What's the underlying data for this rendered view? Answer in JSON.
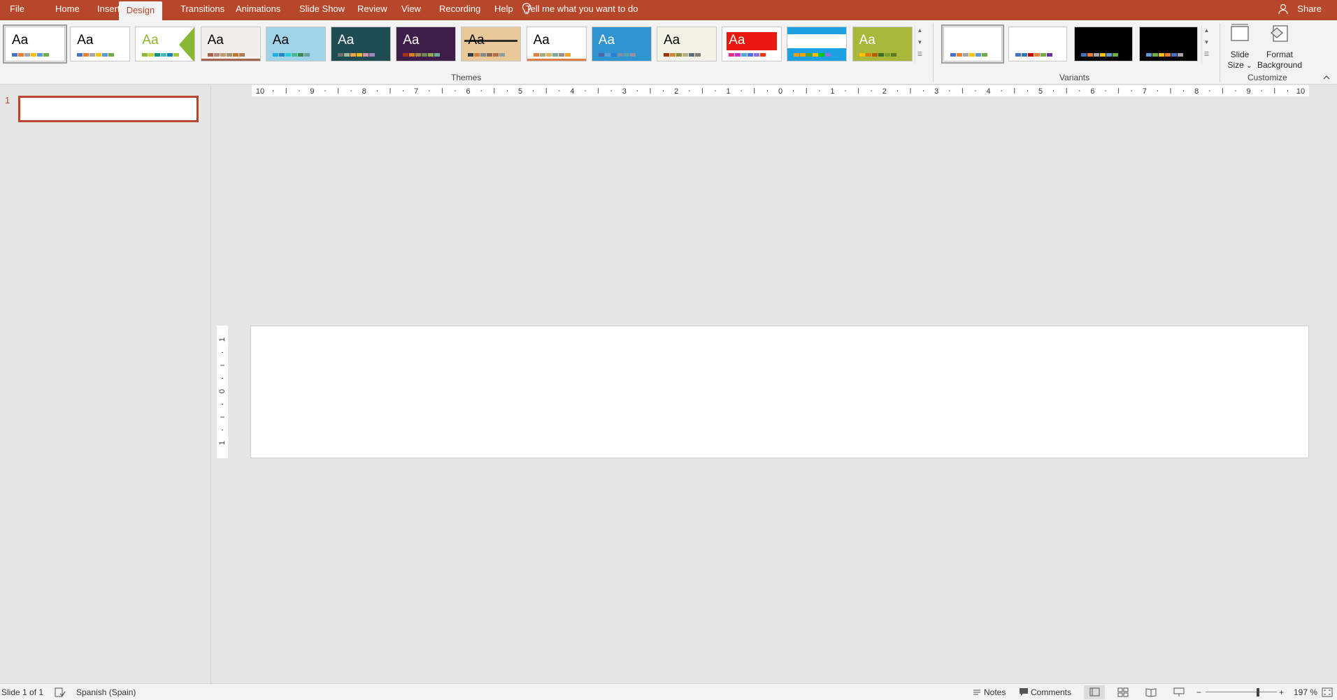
{
  "tabs": [
    {
      "label": "File",
      "active": false
    },
    {
      "label": "Home",
      "active": false
    },
    {
      "label": "Insert",
      "active": false
    },
    {
      "label": "Design",
      "active": true
    },
    {
      "label": "Transitions",
      "active": false
    },
    {
      "label": "Animations",
      "active": false
    },
    {
      "label": "Slide Show",
      "active": false
    },
    {
      "label": "Review",
      "active": false
    },
    {
      "label": "View",
      "active": false
    },
    {
      "label": "Recording",
      "active": false
    },
    {
      "label": "Help",
      "active": false
    }
  ],
  "tell_me": "Tell me what you want to do",
  "share": "Share",
  "ribbon": {
    "themes_label": "Themes",
    "variants_label": "Variants",
    "customize_label": "Customize",
    "theme_aa": "Aa",
    "slide_size": {
      "line1": "Slide",
      "line2": "Size",
      "arrow": "⌄"
    },
    "format_background": {
      "line1": "Format",
      "line2": "Background"
    }
  },
  "themes": [
    {
      "bg": "#ffffff",
      "fg": "#000000",
      "sw": [
        "#4472c4",
        "#ed7d31",
        "#a5a5a5",
        "#ffc000",
        "#5b9bd5",
        "#70ad47"
      ]
    },
    {
      "bg": "#ffffff",
      "fg": "#000000",
      "sw": [
        "#4472c4",
        "#ed7d31",
        "#a5a5a5",
        "#ffc000",
        "#5b9bd5",
        "#70ad47"
      ]
    },
    {
      "bg": "#ffffff",
      "fg": "#8ab833",
      "sw": [
        "#8ab833",
        "#c0cf3a",
        "#029676",
        "#4ab5c4",
        "#0989b1",
        "#a5c249"
      ]
    },
    {
      "bg": "#f2eeea",
      "fg": "#000000",
      "sw": [
        "#a5644e",
        "#b58b80",
        "#c3986d",
        "#a19574",
        "#c17529",
        "#b47a51"
      ]
    },
    {
      "bg": "#9ed3e8",
      "fg": "#000000",
      "sw": [
        "#1cade4",
        "#2683c6",
        "#27ced7",
        "#42ba97",
        "#3e8853",
        "#62a39f"
      ]
    },
    {
      "bg": "#1f4b52",
      "fg": "#ffffff",
      "sw": [
        "#6f6f74",
        "#a5b592",
        "#f3a447",
        "#e7bc29",
        "#d092a7",
        "#9c85c0"
      ]
    },
    {
      "bg": "#3f1d4a",
      "fg": "#ffffff",
      "sw": [
        "#a53010",
        "#de7e18",
        "#9f8351",
        "#728653",
        "#92aa4c",
        "#6aac91"
      ]
    },
    {
      "bg": "#e9c89a",
      "fg": "#000000",
      "sw": [
        "#2e3d49",
        "#d57d3a",
        "#7f8c8d",
        "#8d6b50",
        "#b56b4a",
        "#8b9f9f"
      ]
    },
    {
      "bg": "#ffffff",
      "fg": "#000000",
      "sw": [
        "#dd8047",
        "#a5ab81",
        "#d8b25c",
        "#7ba79d",
        "#968c8c",
        "#f0a22e"
      ]
    },
    {
      "bg": "#2f94cf",
      "fg": "#ffffff",
      "sw": [
        "#4a66ac",
        "#629dd1",
        "#297fd5",
        "#7f8fa9",
        "#5aa2ae",
        "#9d90a0"
      ]
    },
    {
      "bg": "#f2f2e6",
      "fg": "#000000",
      "sw": [
        "#9e3611",
        "#d6862d",
        "#8c8c3c",
        "#b4b080",
        "#586d7f",
        "#877b6f"
      ]
    },
    {
      "bg": "#ffffff",
      "fg": "#ffffff",
      "sw": [
        "#e32d91",
        "#c830cc",
        "#4ea6dc",
        "#4775e7",
        "#8971e1",
        "#f30"
      ]
    },
    {
      "bg": "#1ba1e2",
      "fg": "#ffffff",
      "sw": [
        "#f59e00",
        "#f59e00",
        "#62a420",
        "#ffc000",
        "#0c0",
        "#9370db"
      ]
    },
    {
      "bg": "#a9b83a",
      "fg": "#ffffff",
      "sw": [
        "#ffc000",
        "#d97b09",
        "#b45f06",
        "#3d6b1f",
        "#7e9d28",
        "#5b7d2b"
      ]
    }
  ],
  "variants": [
    {
      "bg": "#ffffff",
      "sw": [
        "#4472c4",
        "#ed7d31",
        "#a5a5a5",
        "#ffc000",
        "#5b9bd5",
        "#70ad47"
      ]
    },
    {
      "bg": "#ffffff",
      "sw": [
        "#4472c4",
        "#2e75b6",
        "#c00000",
        "#ed7d31",
        "#70ad47",
        "#7030a0"
      ]
    },
    {
      "bg": "#000000",
      "sw": [
        "#4472c4",
        "#ed7d31",
        "#a5a5a5",
        "#ffc000",
        "#5b9bd5",
        "#70ad47"
      ]
    },
    {
      "bg": "#000000",
      "sw": [
        "#5b9bd5",
        "#70ad47",
        "#ffc000",
        "#ed7d31",
        "#4472c4",
        "#a5a5a5"
      ]
    }
  ],
  "hruler_labels": [
    "10",
    "9",
    "8",
    "7",
    "6",
    "5",
    "4",
    "3",
    "2",
    "1",
    "0",
    "1",
    "2",
    "3",
    "4",
    "5",
    "6",
    "7",
    "8",
    "9",
    "10"
  ],
  "vruler_labels": [
    "1",
    "0",
    "1"
  ],
  "thumbnail": {
    "number": "1"
  },
  "status": {
    "slide_of": "Slide 1 of 1",
    "language": "Spanish (Spain)",
    "notes": "Notes",
    "comments": "Comments",
    "zoom": "197 %",
    "zoom_level_percent": 197
  }
}
